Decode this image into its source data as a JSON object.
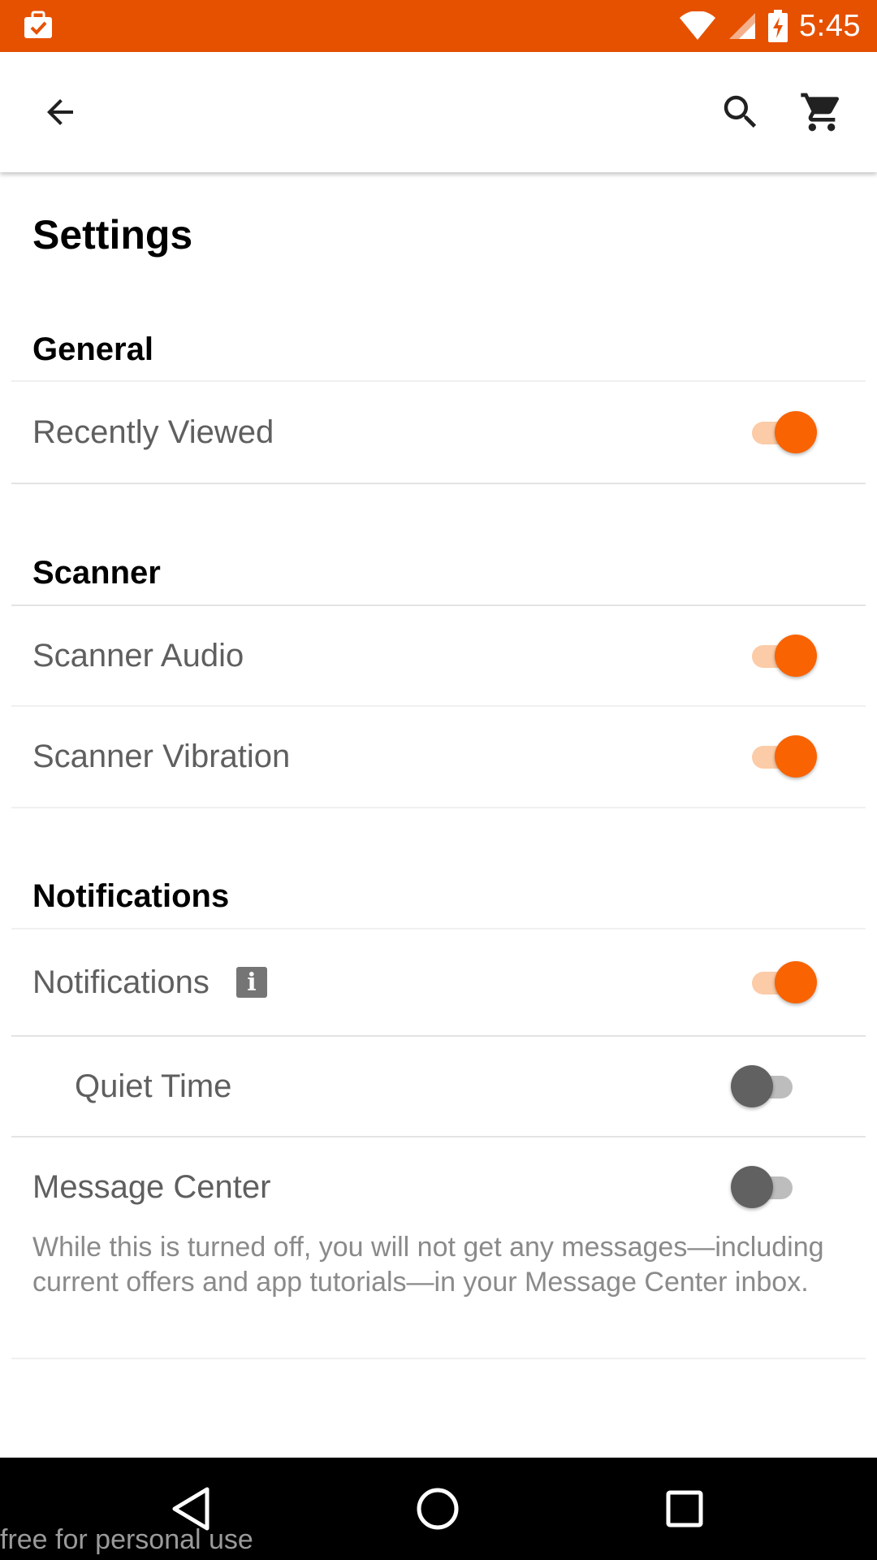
{
  "colors": {
    "status_bar": "#E65100",
    "accent": "#F96302",
    "accent_track": "#fccba7"
  },
  "status_bar": {
    "left_icon": "briefcase-check-icon",
    "time": "5:45",
    "icons": [
      "wifi-icon",
      "signal-icon",
      "battery-charging-icon"
    ]
  },
  "app_bar": {
    "back_icon": "arrow-back-icon",
    "search_icon": "search-icon",
    "cart_icon": "cart-icon"
  },
  "page": {
    "title": "Settings"
  },
  "sections": {
    "general": {
      "title": "General",
      "recently_viewed": {
        "label": "Recently Viewed",
        "enabled": true
      }
    },
    "scanner": {
      "title": "Scanner",
      "audio": {
        "label": "Scanner Audio",
        "enabled": true
      },
      "vibration": {
        "label": "Scanner Vibration",
        "enabled": true
      }
    },
    "notifications": {
      "title": "Notifications",
      "notifications": {
        "label": "Notifications",
        "enabled": true,
        "info_icon": "info-icon"
      },
      "quiet_time": {
        "label": "Quiet Time",
        "enabled": false
      },
      "message_center": {
        "label": "Message Center",
        "enabled": false,
        "description": "While this is turned off, you will not get any messages—including current offers and app tutorials—in your Message Center inbox."
      }
    }
  },
  "nav_bar": {
    "back_icon": "nav-back-icon",
    "home_icon": "nav-home-icon",
    "recents_icon": "nav-recents-icon"
  },
  "watermark": "free for personal use"
}
